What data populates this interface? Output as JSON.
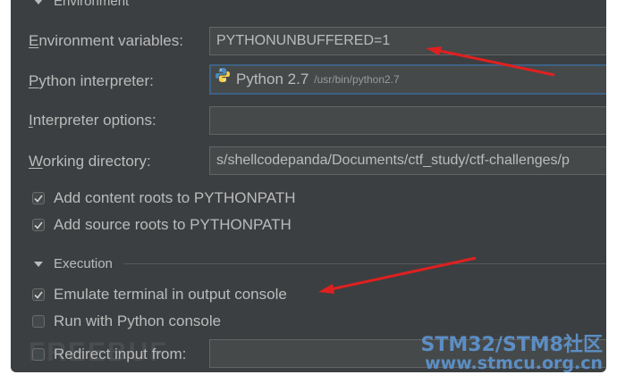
{
  "environment": {
    "header": "Environment",
    "fields": {
      "env_vars": {
        "mnemonic": "E",
        "rest": "nvironment variables:",
        "value": "PYTHONUNBUFFERED=1"
      },
      "interpreter": {
        "mnemonic": "P",
        "rest": "ython interpreter:",
        "name": "Python 2.7",
        "path": "/usr/bin/python2.7",
        "icon": "python-logo-icon"
      },
      "interp_options": {
        "mnemonic": "I",
        "rest": "nterpreter options:",
        "value": ""
      },
      "working_dir": {
        "mnemonic": "W",
        "rest": "orking directory:",
        "value": "s/shellcodepanda/Documents/ctf_study/ctf-challenges/p"
      }
    },
    "checks": [
      {
        "label": "Add content roots to PYTHONPATH",
        "checked": true
      },
      {
        "label": "Add source roots to PYTHONPATH",
        "checked": true
      }
    ]
  },
  "execution": {
    "header": "Execution",
    "checks": [
      {
        "label": "Emulate terminal in output console",
        "checked": true
      },
      {
        "label": "Run with Python console",
        "checked": false
      },
      {
        "label": "Redirect input from:",
        "checked": false
      }
    ],
    "redirect_value": ""
  },
  "watermark": {
    "faint": "FREEBUF",
    "cn": "STM32/STM8社区",
    "url": "www.stmcu.org.cn"
  },
  "colors": {
    "panel_bg": "#3c3f41",
    "text": "#bbbbbb",
    "arrow": "#e02020",
    "watermark": "#5c8ec4"
  }
}
